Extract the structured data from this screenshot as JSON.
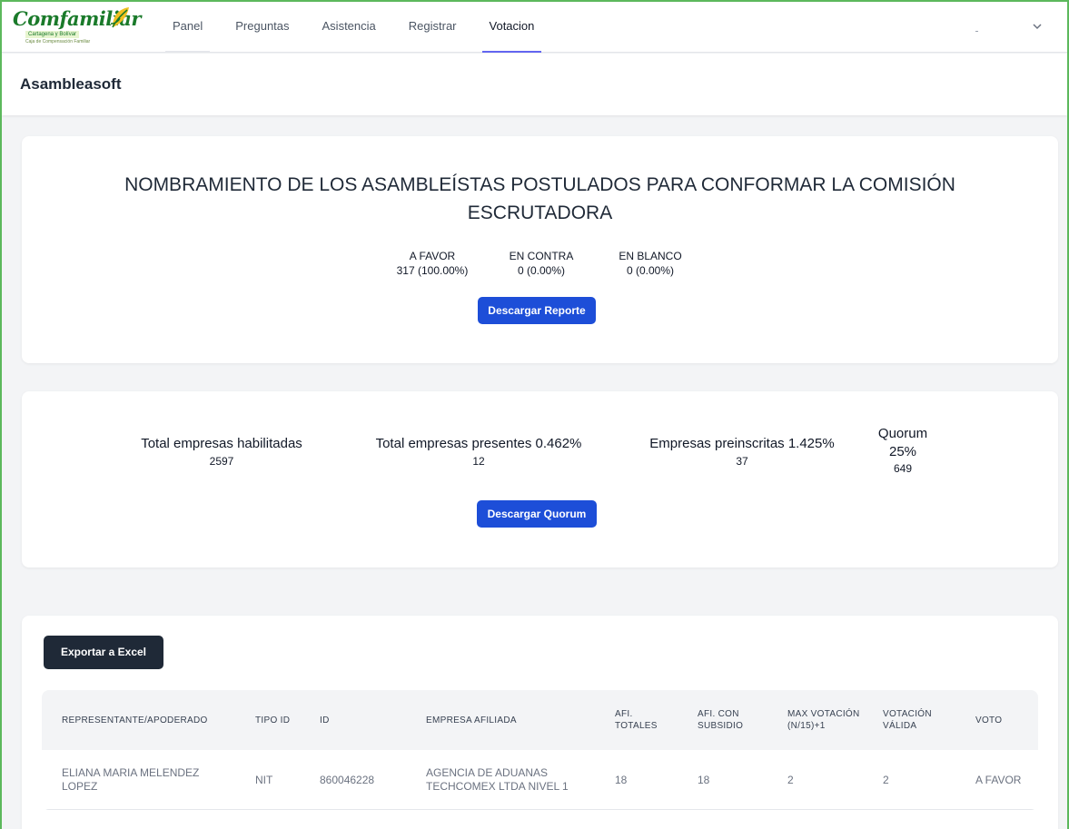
{
  "brand": {
    "logo_text": "Comfamiliar",
    "logo_subtitle": "Cartagena y Bolívar",
    "logo_tagline": "Caja de Compensación Familiar",
    "color": "#1a7a2a"
  },
  "nav": {
    "items": [
      {
        "label": "Panel",
        "active": false
      },
      {
        "label": "Preguntas",
        "active": false
      },
      {
        "label": "Asistencia",
        "active": false
      },
      {
        "label": "Registrar",
        "active": false
      },
      {
        "label": "Votacion",
        "active": true
      }
    ],
    "chevron_icon": "chevron-down-icon"
  },
  "header": {
    "title": "Asambleasoft"
  },
  "question": {
    "title": "NOMBRAMIENTO DE LOS ASAMBLEÍSTAS POSTULADOS PARA CONFORMAR LA COMISIÓN ESCRUTADORA",
    "results": [
      {
        "label": "A FAVOR",
        "value": "317 (100.00%)"
      },
      {
        "label": "EN CONTRA",
        "value": "0 (0.00%)"
      },
      {
        "label": "EN BLANCO",
        "value": "0 (0.00%)"
      }
    ],
    "download_label": "Descargar Reporte"
  },
  "quorum": {
    "stats": [
      {
        "label": "Total empresas habilitadas",
        "value": "2597"
      },
      {
        "label": "Total empresas presentes 0.462%",
        "value": "12"
      },
      {
        "label": "Empresas preinscritas 1.425%",
        "value": "37"
      }
    ],
    "quorum_label": "Quorum",
    "quorum_percent": "25%",
    "quorum_value": "649",
    "download_label": "Descargar Quorum"
  },
  "table": {
    "export_label": "Exportar a Excel",
    "columns": [
      "REPRESENTANTE/APODERADO",
      "TIPO ID",
      "ID",
      "EMPRESA AFILIADA",
      "AFI. TOTALES",
      "AFI. CON SUBSIDIO",
      "MAX VOTACIÓN (N/15)+1",
      "VOTACIÓN VÁLIDA",
      "VOTO"
    ],
    "rows": [
      {
        "representante": "ELIANA MARIA MELENDEZ LOPEZ",
        "tipo_id": "NIT",
        "id": "860046228",
        "empresa": "AGENCIA DE ADUANAS TECHCOMEX LTDA NIVEL 1",
        "afi_totales": "18",
        "afi_subsidio": "18",
        "max_votacion": "2",
        "votacion_valida": "2",
        "voto": "A FAVOR"
      }
    ]
  },
  "colors": {
    "primary_button": "#1d4ed8",
    "dark_button": "#1f2937",
    "active_tab": "#6366f1",
    "frame": "#5cb85c"
  }
}
